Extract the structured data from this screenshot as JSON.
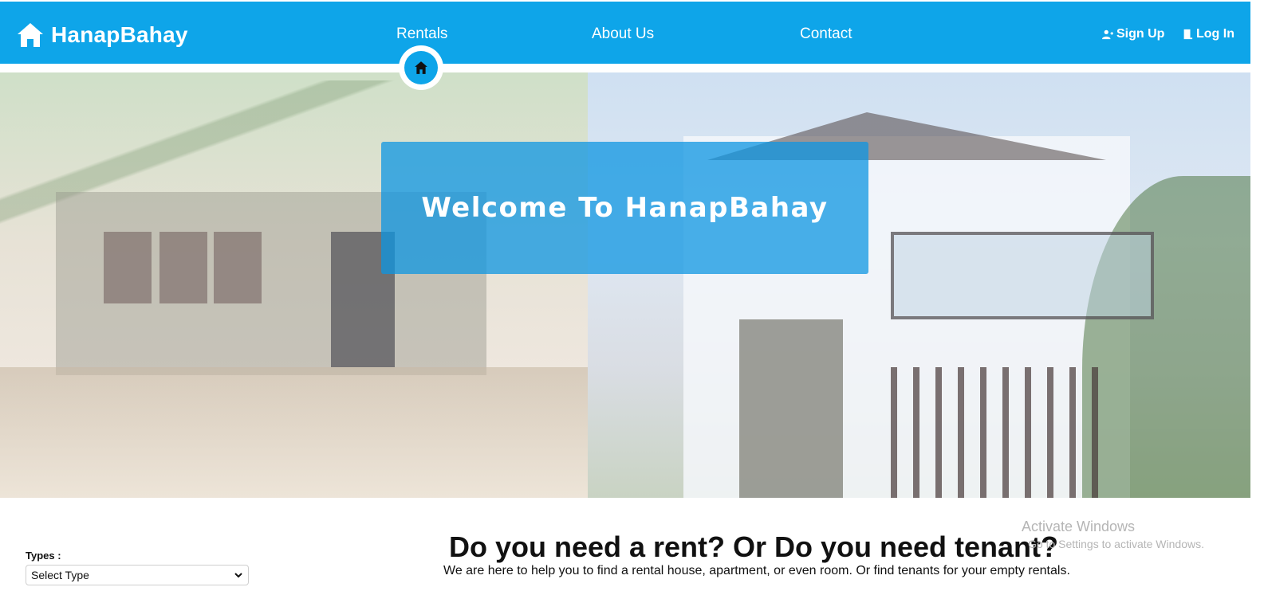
{
  "header": {
    "brand": "HanapBahay",
    "nav": {
      "rentals": "Rentals",
      "about": "About Us",
      "contact": "Contact"
    },
    "auth": {
      "signup": "Sign Up",
      "login": "Log In"
    },
    "active_nav": "Rentals",
    "icons": {
      "brand": "home-icon",
      "active": "home-icon",
      "signup": "user-add-icon",
      "login": "login-door-icon"
    }
  },
  "hero": {
    "welcome": "Welcome To HanapBahay"
  },
  "main": {
    "tagline": "Do you need a rent? Or Do you need tenant?",
    "subtitle": "We are here to help you to find a rental house, apartment, or even room. Or find tenants for your empty rentals."
  },
  "filters": {
    "types_label": "Types :",
    "types_value": "Select Type"
  },
  "watermark": {
    "line1": "Activate Windows",
    "line2": "Go to Settings to activate Windows."
  },
  "colors": {
    "primary": "#0ea5e9",
    "text": "#111111"
  }
}
